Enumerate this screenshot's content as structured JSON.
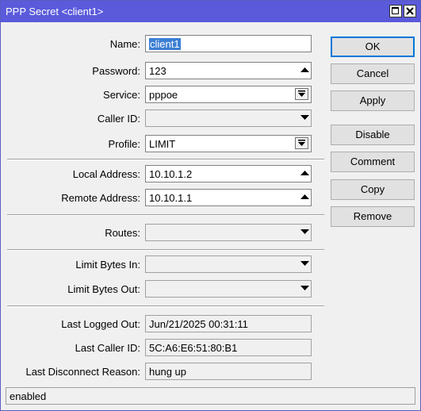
{
  "window": {
    "title": "PPP Secret <client1>"
  },
  "form": {
    "name": {
      "label": "Name:",
      "value": "client1"
    },
    "password": {
      "label": "Password:",
      "value": "123"
    },
    "service": {
      "label": "Service:",
      "value": "pppoe"
    },
    "caller_id": {
      "label": "Caller ID:",
      "value": ""
    },
    "profile": {
      "label": "Profile:",
      "value": "LIMIT"
    },
    "local_address": {
      "label": "Local Address:",
      "value": "10.10.1.2"
    },
    "remote_address": {
      "label": "Remote Address:",
      "value": "10.10.1.1"
    },
    "routes": {
      "label": "Routes:",
      "value": ""
    },
    "limit_bytes_in": {
      "label": "Limit Bytes In:",
      "value": ""
    },
    "limit_bytes_out": {
      "label": "Limit Bytes Out:",
      "value": ""
    },
    "last_logged_out": {
      "label": "Last Logged Out:",
      "value": "Jun/21/2025 00:31:11"
    },
    "last_caller_id": {
      "label": "Last Caller ID:",
      "value": "5C:A6:E6:51:80:B1"
    },
    "last_disconnect_reason": {
      "label": "Last Disconnect Reason:",
      "value": "hung up"
    }
  },
  "buttons": {
    "ok": "OK",
    "cancel": "Cancel",
    "apply": "Apply",
    "disable": "Disable",
    "comment": "Comment",
    "copy": "Copy",
    "remove": "Remove"
  },
  "status": {
    "text": "enabled"
  },
  "icons": {
    "collapse": "triangle-up-icon",
    "expand": "triangle-down-icon",
    "dropdown": "dropdown-arrow-icon",
    "maximize": "maximize-icon",
    "close": "close-icon"
  },
  "colors": {
    "titlebar": "#5a5adb",
    "selection": "#3c7fd4"
  }
}
